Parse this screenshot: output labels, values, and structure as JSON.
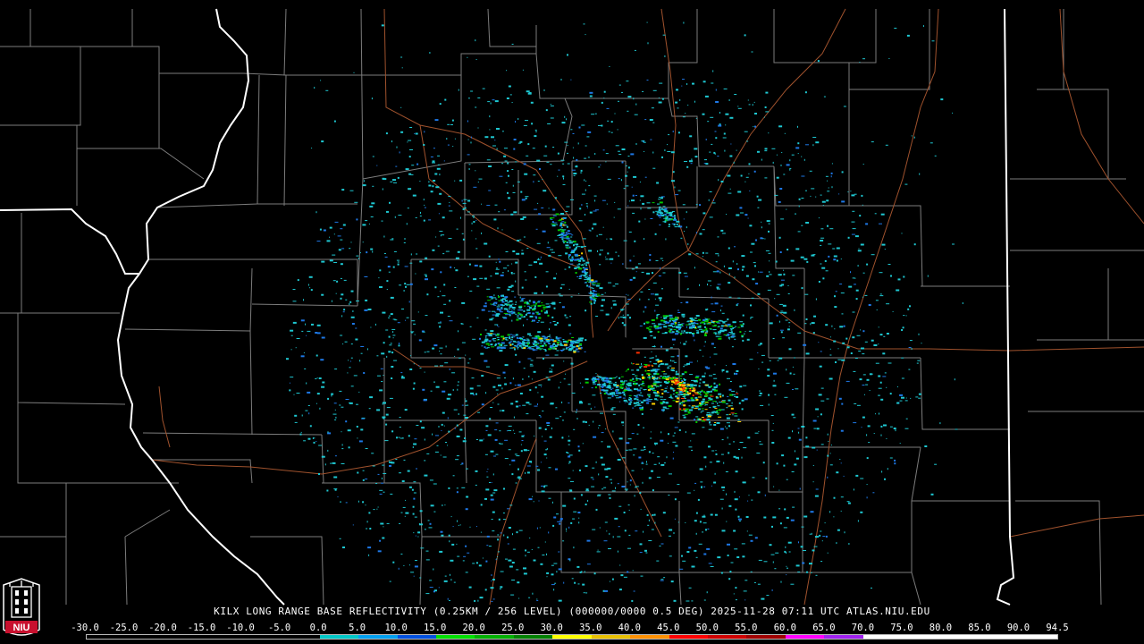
{
  "caption": "KILX LONG RANGE BASE REFLECTIVITY (0.25KM / 256 LEVEL) (000000/0000 0.5 DEG) 2025-11-28 07:11 UTC  ATLAS.NIU.EDU",
  "logo": {
    "text": "NIU",
    "icon": "niu-tower-shield-icon"
  },
  "scale": {
    "labels": [
      "-30.0",
      "-25.0",
      "-20.0",
      "-15.0",
      "-10.0",
      "-5.0",
      "0.0",
      "5.0",
      "10.0",
      "15.0",
      "20.0",
      "25.0",
      "30.0",
      "35.0",
      "40.0",
      "45.0",
      "50.0",
      "55.0",
      "60.0",
      "65.0",
      "70.0",
      "75.0",
      "80.0",
      "85.0",
      "90.0",
      "94.5"
    ],
    "colors": [
      "#000000",
      "#000000",
      "#000000",
      "#000000",
      "#000000",
      "#000000",
      "#00c8c8",
      "#00a0f0",
      "#0050e0",
      "#00e000",
      "#00b000",
      "#008000",
      "#ffff00",
      "#e8c000",
      "#ff9000",
      "#ff0000",
      "#d00000",
      "#a00000",
      "#ff00ff",
      "#a020f0",
      "#ffffff",
      "#ffffff",
      "#ffffff",
      "#ffffff",
      "#ffffff"
    ]
  },
  "map": {
    "radar_site": "KILX",
    "colors": {
      "background": "#000000",
      "state_border": "#ffffff",
      "county_border": "#8c8c8c",
      "highway": "#a0522d",
      "echo_light": "#1ec8d2",
      "echo_mid": "#1e78e6",
      "echo_heavy": "#00c800",
      "echo_core": "#ffd200",
      "echo_peak": "#ff3000"
    }
  }
}
